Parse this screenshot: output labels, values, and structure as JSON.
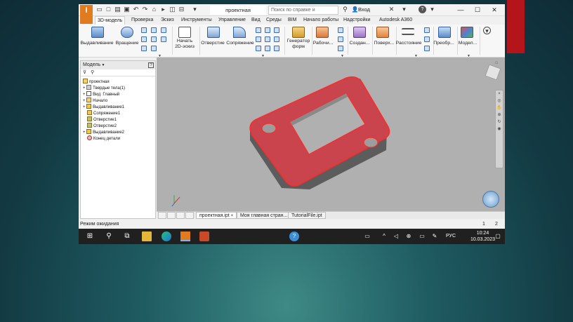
{
  "app": {
    "logo_text": "I",
    "document_tab": "проектная",
    "search_placeholder": "Поиск по справке и командам",
    "signin_label": "Вход",
    "help_icon": "?"
  },
  "quick_access": [
    "doc-icon",
    "new-icon",
    "open-icon",
    "save-icon",
    "undo-icon",
    "redo-icon",
    "home-icon",
    "select-icon",
    "properties-icon",
    "measure-icon"
  ],
  "window_controls": [
    "minimize",
    "maximize",
    "close"
  ],
  "tabs": [
    {
      "label": "3D-модель",
      "active": true
    },
    {
      "label": "Проверка"
    },
    {
      "label": "Эскиз"
    },
    {
      "label": "Инструменты"
    },
    {
      "label": "Управление"
    },
    {
      "label": "Вид"
    },
    {
      "label": "Среды"
    },
    {
      "label": "BIM"
    },
    {
      "label": "Начало работы"
    },
    {
      "label": "Надстройки"
    },
    {
      "label": "Autodesk A360"
    }
  ],
  "ribbon": {
    "extrude": "Выдавливание",
    "revolve": "Вращение",
    "start_sketch_line1": "Начать",
    "start_sketch_line2": "2D-эскиз",
    "hole": "Отверстие",
    "fillet": "Сопряжение",
    "frame_gen_line1": "Генератор",
    "frame_gen_line2": "форм",
    "work": "Рабочи...",
    "create": "Создан...",
    "surface": "Поверх...",
    "distance": "Расстояние",
    "convert": "Преобр...",
    "model": "Модел..."
  },
  "browser": {
    "title": "Модель",
    "tree": [
      {
        "label": "проектная",
        "level": 0
      },
      {
        "label": "Твердые тела(1)",
        "level": 1
      },
      {
        "label": "Вид: Главный",
        "level": 1
      },
      {
        "label": "Начало",
        "level": 1
      },
      {
        "label": "Выдавливание1",
        "level": 1
      },
      {
        "label": "Сопряжение1",
        "level": 1
      },
      {
        "label": "Отверстие1",
        "level": 1
      },
      {
        "label": "Отверстие2",
        "level": 1
      },
      {
        "label": "Выдавливание2",
        "level": 1
      },
      {
        "label": "Конец детали",
        "level": 1
      }
    ]
  },
  "doc_tabs": [
    "проектная.ipt",
    "Моя главная стран...",
    "TutorialFile.ipt"
  ],
  "status": {
    "text": "Режим ожидания",
    "num1": "1",
    "num2": "2"
  },
  "taskbar": {
    "lang": "РУС",
    "time": "10:24",
    "date": "10.03.2023"
  },
  "colors": {
    "accent_red": "#b3151b",
    "part_red": "#e0414b",
    "viewport_gray": "#b0b0b0",
    "inventor_orange": "#e07b1e"
  }
}
